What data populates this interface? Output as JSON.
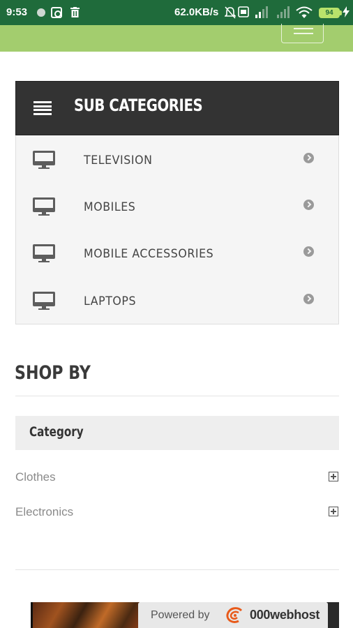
{
  "status_bar": {
    "time": "9:53",
    "network_speed": "62.0KB/s",
    "battery_level": "94",
    "icons": [
      "notification-dot-icon",
      "app-icon",
      "trash-icon",
      "mute-icon",
      "sim-icon",
      "signal-icon",
      "wifi-icon",
      "battery-icon",
      "charging-icon"
    ]
  },
  "header": {
    "menu_icon": "hamburger-icon",
    "bar_color": "#a3cd6e"
  },
  "sub_categories": {
    "title": "SUB CATEGORIES",
    "items": [
      {
        "label": "TELEVISION",
        "icon": "monitor-icon"
      },
      {
        "label": "MOBILES",
        "icon": "monitor-icon"
      },
      {
        "label": "MOBILE ACCESSORIES",
        "icon": "monitor-icon"
      },
      {
        "label": "LAPTOPS",
        "icon": "monitor-icon"
      }
    ]
  },
  "shop_by": {
    "title": "SHOP BY",
    "category_label": "Category",
    "filters": [
      {
        "label": "Clothes",
        "icon": "plus-box-icon"
      },
      {
        "label": "Electronics",
        "icon": "plus-box-icon"
      }
    ]
  },
  "footer_banner": {
    "powered_by": "Powered by",
    "brand": "000webhost"
  },
  "colors": {
    "status_bar": "#1f6b3b",
    "header_green": "#a3cd6e",
    "panel_header": "#333333"
  }
}
